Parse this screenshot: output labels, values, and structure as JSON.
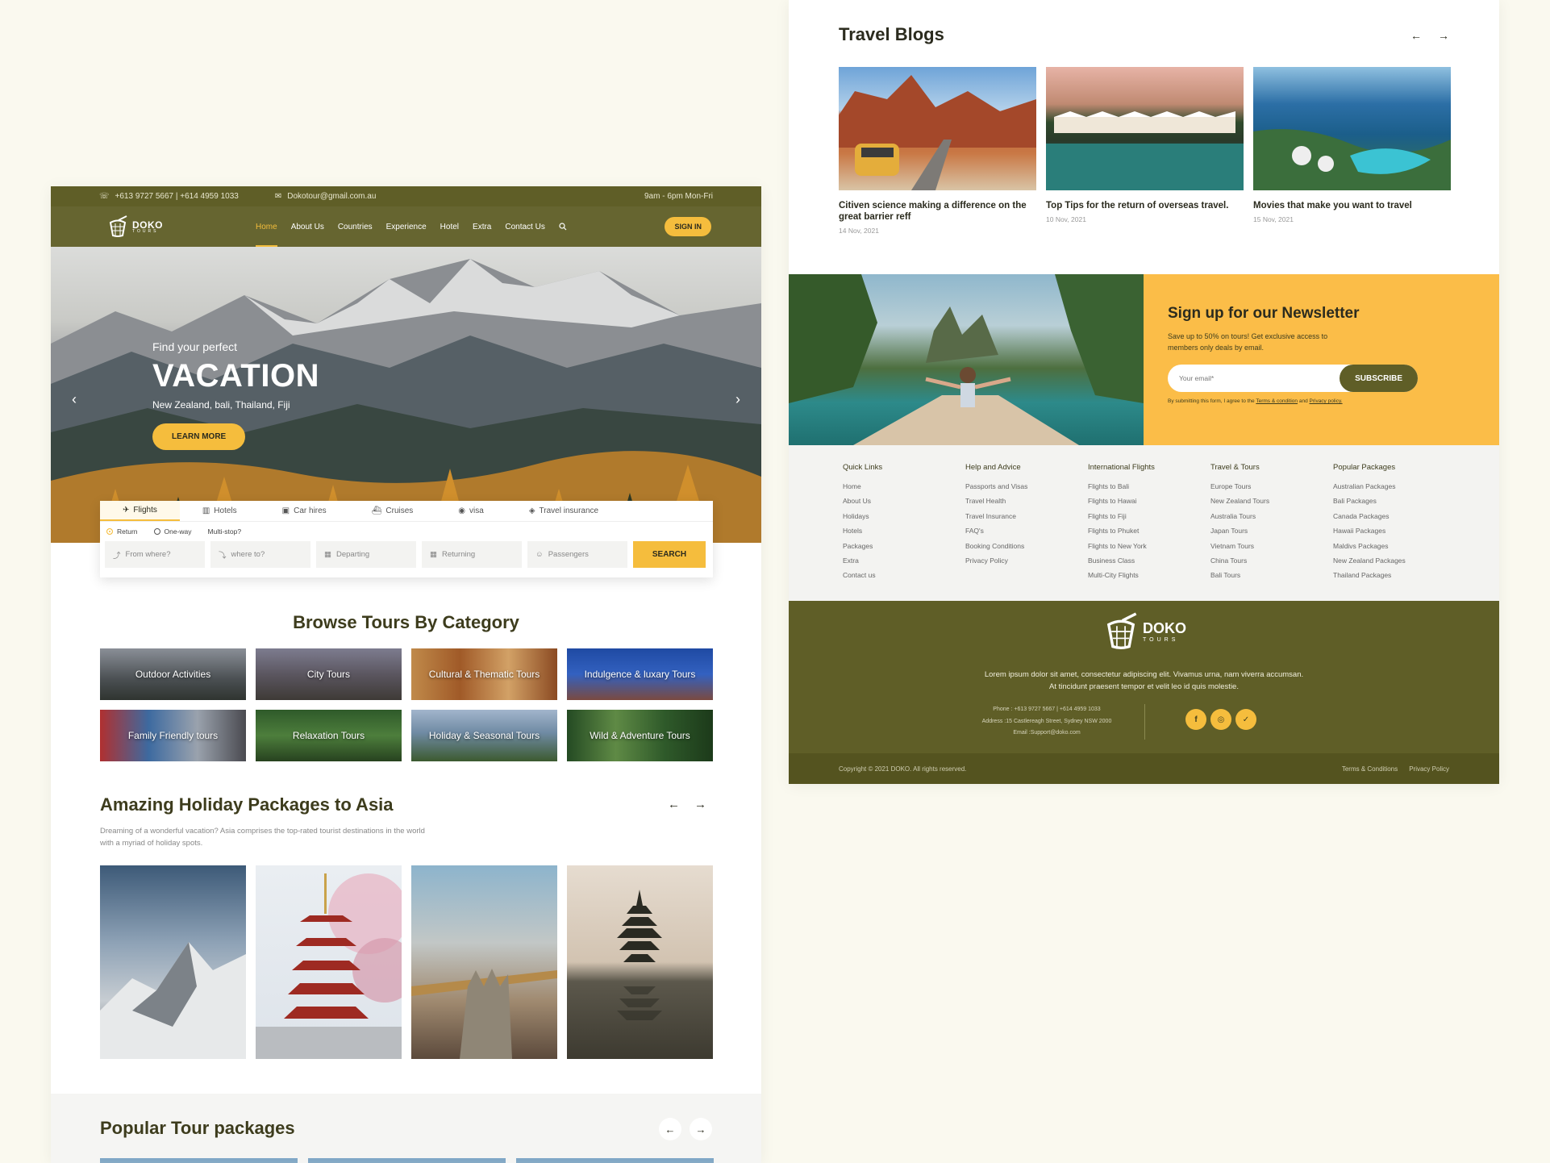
{
  "topbar": {
    "phone": "+613 9727 5667 | +614 4959 1033",
    "email": "Dokotour@gmail.com.au",
    "hours": "9am - 6pm Mon-Fri"
  },
  "brand": {
    "name": "DOKO",
    "tagline": "TOURS"
  },
  "nav": {
    "items": [
      {
        "label": "Home",
        "active": true
      },
      {
        "label": "About Us"
      },
      {
        "label": "Countries"
      },
      {
        "label": "Experience"
      },
      {
        "label": "Hotel"
      },
      {
        "label": "Extra"
      },
      {
        "label": "Contact Us"
      }
    ],
    "signin": "SIGN IN"
  },
  "hero": {
    "kicker": "Find your perfect",
    "title": "VACATION",
    "subtitle": "New Zealand, bali, Thailand, Fiji",
    "cta": "LEARN MORE"
  },
  "search": {
    "tabs": [
      "Flights",
      "Hotels",
      "Car hires",
      "Cruises",
      "visa",
      "Travel insurance"
    ],
    "trip_types": [
      "Return",
      "One-way",
      "Multi-stop?"
    ],
    "fields": [
      "From where?",
      "where to?",
      "Departing",
      "Returning",
      "Passengers"
    ],
    "button": "SEARCH"
  },
  "browse": {
    "title": "Browse Tours By Category",
    "categories": [
      "Outdoor Activities",
      "City Tours",
      "Cultural & Thematic Tours",
      "Indulgence & luxary Tours",
      "Family Friendly tours",
      "Relaxation Tours",
      "Holiday & Seasonal Tours",
      "Wild & Adventure Tours"
    ]
  },
  "asia": {
    "title": "Amazing Holiday Packages to Asia",
    "desc": "Dreaming of a wonderful vacation? Asia comprises the top-rated tourist destinations in the world with a myriad of holiday spots."
  },
  "popular": {
    "title": "Popular Tour packages"
  },
  "blogs": {
    "title": "Travel Blogs",
    "items": [
      {
        "title": "Citiven science making a difference on the great barrier reff",
        "date": "14 Nov, 2021"
      },
      {
        "title": "Top Tips for the return of overseas travel.",
        "date": "10 Nov, 2021"
      },
      {
        "title": "Movies that make you want to travel",
        "date": "15 Nov, 2021"
      }
    ]
  },
  "newsletter": {
    "title": "Sign up for our Newsletter",
    "desc": "Save up to 50% on tours! Get exclusive access to members only deals by email.",
    "placeholder": "Your email*",
    "button": "SUBSCRIBE",
    "legal_prefix": "By submitting this form, I agree to the ",
    "terms": "Terms & condition",
    "and": " and ",
    "privacy": "Privacy policy."
  },
  "links": [
    {
      "heading": "Quick Links",
      "items": [
        "Home",
        "About Us",
        "Holidays",
        "Hotels",
        "Packages",
        "Extra",
        "Contact us"
      ]
    },
    {
      "heading": "Help and Advice",
      "items": [
        "Passports and Visas",
        "Travel Health",
        "Travel Insurance",
        "FAQ's",
        "Booking Conditions",
        "Privacy Policy"
      ]
    },
    {
      "heading": "International Flights",
      "items": [
        "Flights to Bali",
        "Flights to Hawai",
        "Flights to Fiji",
        "Flights to Phuket",
        "Flights to New York",
        "Business Class",
        "Multi-City Flights"
      ]
    },
    {
      "heading": "Travel & Tours",
      "items": [
        "Europe Tours",
        "New Zealand Tours",
        "Australia Tours",
        "Japan Tours",
        "Vietnam Tours",
        "China Tours",
        "Bali Tours"
      ]
    },
    {
      "heading": "Popular Packages",
      "items": [
        "Australian Packages",
        "Bali Packages",
        "Canada Packages",
        "Hawaii Packages",
        "Maldivs Packages",
        "New Zealand Packages",
        "Thailand Packages"
      ]
    }
  ],
  "footer": {
    "desc": "Lorem ipsum dolor sit amet, consectetur adipiscing elit. Vivamus urna, nam viverra accumsan. At tincidunt praesent tempor et velit leo id quis molestie.",
    "phone": "Phone : +613 9727 5667 | +614 4959 1033",
    "address": "Address :15 Castlereagh Street, Sydney NSW 2000",
    "email": "Email :Support@doko.com",
    "copyright": "Copyright © 2021 DOKO. All rights reserved.",
    "terms": "Terms & Conditions",
    "privacy": "Privacy Policy"
  },
  "colors": {
    "olive": "#5f5e27",
    "accent": "#f5bd3d",
    "newsletter_bg": "#fbbd48",
    "page_bg": "#faf9ef"
  }
}
